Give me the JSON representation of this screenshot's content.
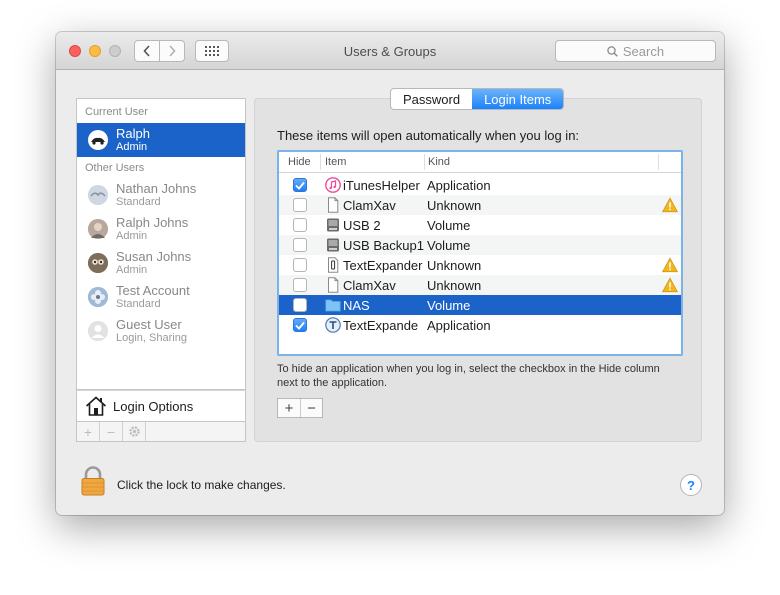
{
  "window": {
    "title": "Users & Groups"
  },
  "search": {
    "placeholder": "Search"
  },
  "sidebar": {
    "current_user_label": "Current User",
    "current_user": {
      "name": "Ralph",
      "role": "Admin"
    },
    "other_users_label": "Other Users",
    "other_users": [
      {
        "name": "Nathan Johns",
        "role": "Standard"
      },
      {
        "name": "Ralph Johns",
        "role": "Admin"
      },
      {
        "name": "Susan Johns",
        "role": "Admin"
      },
      {
        "name": "Test Account",
        "role": "Standard"
      },
      {
        "name": "Guest User",
        "role": "Login, Sharing"
      }
    ],
    "login_options_label": "Login Options",
    "tools": {
      "add": "+",
      "remove": "−"
    }
  },
  "tabs": [
    {
      "label": "Password"
    },
    {
      "label": "Login Items"
    }
  ],
  "main": {
    "message": "These items will open automatically when you log in:",
    "columns": {
      "hide": "Hide",
      "item": "Item",
      "kind": "Kind"
    },
    "rows": [
      {
        "hide": true,
        "name": "iTunesHelper",
        "kind": "Application",
        "icon": "itunes-icon",
        "warning": false
      },
      {
        "hide": false,
        "name": "ClamXav",
        "kind": "Unknown",
        "icon": "document-icon",
        "warning": true
      },
      {
        "hide": false,
        "name": "USB 2",
        "kind": "Volume",
        "icon": "drive-icon",
        "warning": false
      },
      {
        "hide": false,
        "name": "USB Backup1",
        "kind": "Volume",
        "icon": "drive-icon",
        "warning": false
      },
      {
        "hide": false,
        "name": "TextExpander",
        "kind": "Unknown",
        "icon": "document-icon",
        "warning": true
      },
      {
        "hide": false,
        "name": "ClamXav",
        "kind": "Unknown",
        "icon": "document-icon",
        "warning": true
      },
      {
        "hide": false,
        "name": "NAS",
        "kind": "Volume",
        "icon": "folder-icon",
        "warning": false
      },
      {
        "hide": true,
        "name": "TextExpande",
        "kind": "Application",
        "icon": "textexpander-icon",
        "warning": false
      }
    ],
    "hint": "To hide an application when you log in, select the checkbox in the Hide column next to the application.",
    "add": "+",
    "remove": "−"
  },
  "footer": {
    "lock_text": "Click the lock to make changes.",
    "help": "?"
  },
  "colors": {
    "accent": "#1b63c8",
    "selected_tab": "#1a82fb",
    "warning": "#f2b51a"
  }
}
